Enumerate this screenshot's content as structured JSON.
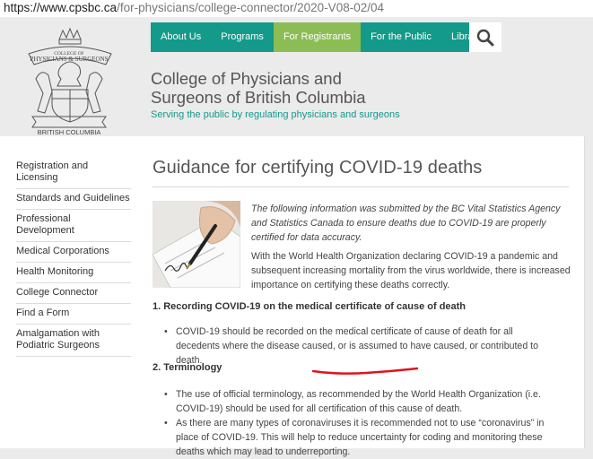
{
  "browser": {
    "url_main": "https://www.cpsbc.ca",
    "url_path": "/for-physicians/college-connector/2020-V08-02/04"
  },
  "header": {
    "logo_text_bottom": "BRITISH COLUMBIA",
    "title_line1": "College of Physicians and",
    "title_line2": "Surgeons of British Columbia",
    "tagline": "Serving the public by regulating physicians and surgeons"
  },
  "nav": {
    "items": [
      "About Us",
      "Programs",
      "For Registrants",
      "For the Public",
      "Library"
    ],
    "active": "For Registrants"
  },
  "sidebar": {
    "items": [
      "Registration and Licensing",
      "Standards and Guidelines",
      "Professional Development",
      "Medical Corporations",
      "Health Monitoring",
      "College Connector",
      "Find a Form",
      "Amalgamation with Podiatric Surgeons"
    ]
  },
  "article": {
    "title": "Guidance for certifying COVID-19 deaths",
    "intro": "The following information was submitted by the BC Vital Statistics Agency and Statistics Canada to ensure deaths due to COVID-19 are properly certified for data accuracy.",
    "paragraph": "With the World Health Organization declaring COVID-19 a pandemic and subsequent increasing mortality from the virus worldwide, there is increased importance on certifying these deaths correctly.",
    "section1_heading": "1. Recording COVID-19 on the medical certificate of cause of death",
    "section1_bullet1": "COVID-19 should be recorded on the medical certificate of cause of death for all decedents where the disease caused, or is assumed to have caused, or contributed to death.",
    "section2_heading": "2. Terminology",
    "section2_bullet1": "The use of official terminology, as recommended by the World Health Organization (i.e. COVID-19) should be used for all certification of this cause of death.",
    "section2_bullet2": "As there are many types of coronaviruses it is recommended not to use “coronavirus” in place of COVID-19. This will help to reduce uncertainty for coding and monitoring these deaths which may lead to underreporting."
  },
  "colors": {
    "nav_teal": "#139a8a",
    "nav_active_green": "#8cbd54",
    "annotation_red": "#e0141e"
  }
}
